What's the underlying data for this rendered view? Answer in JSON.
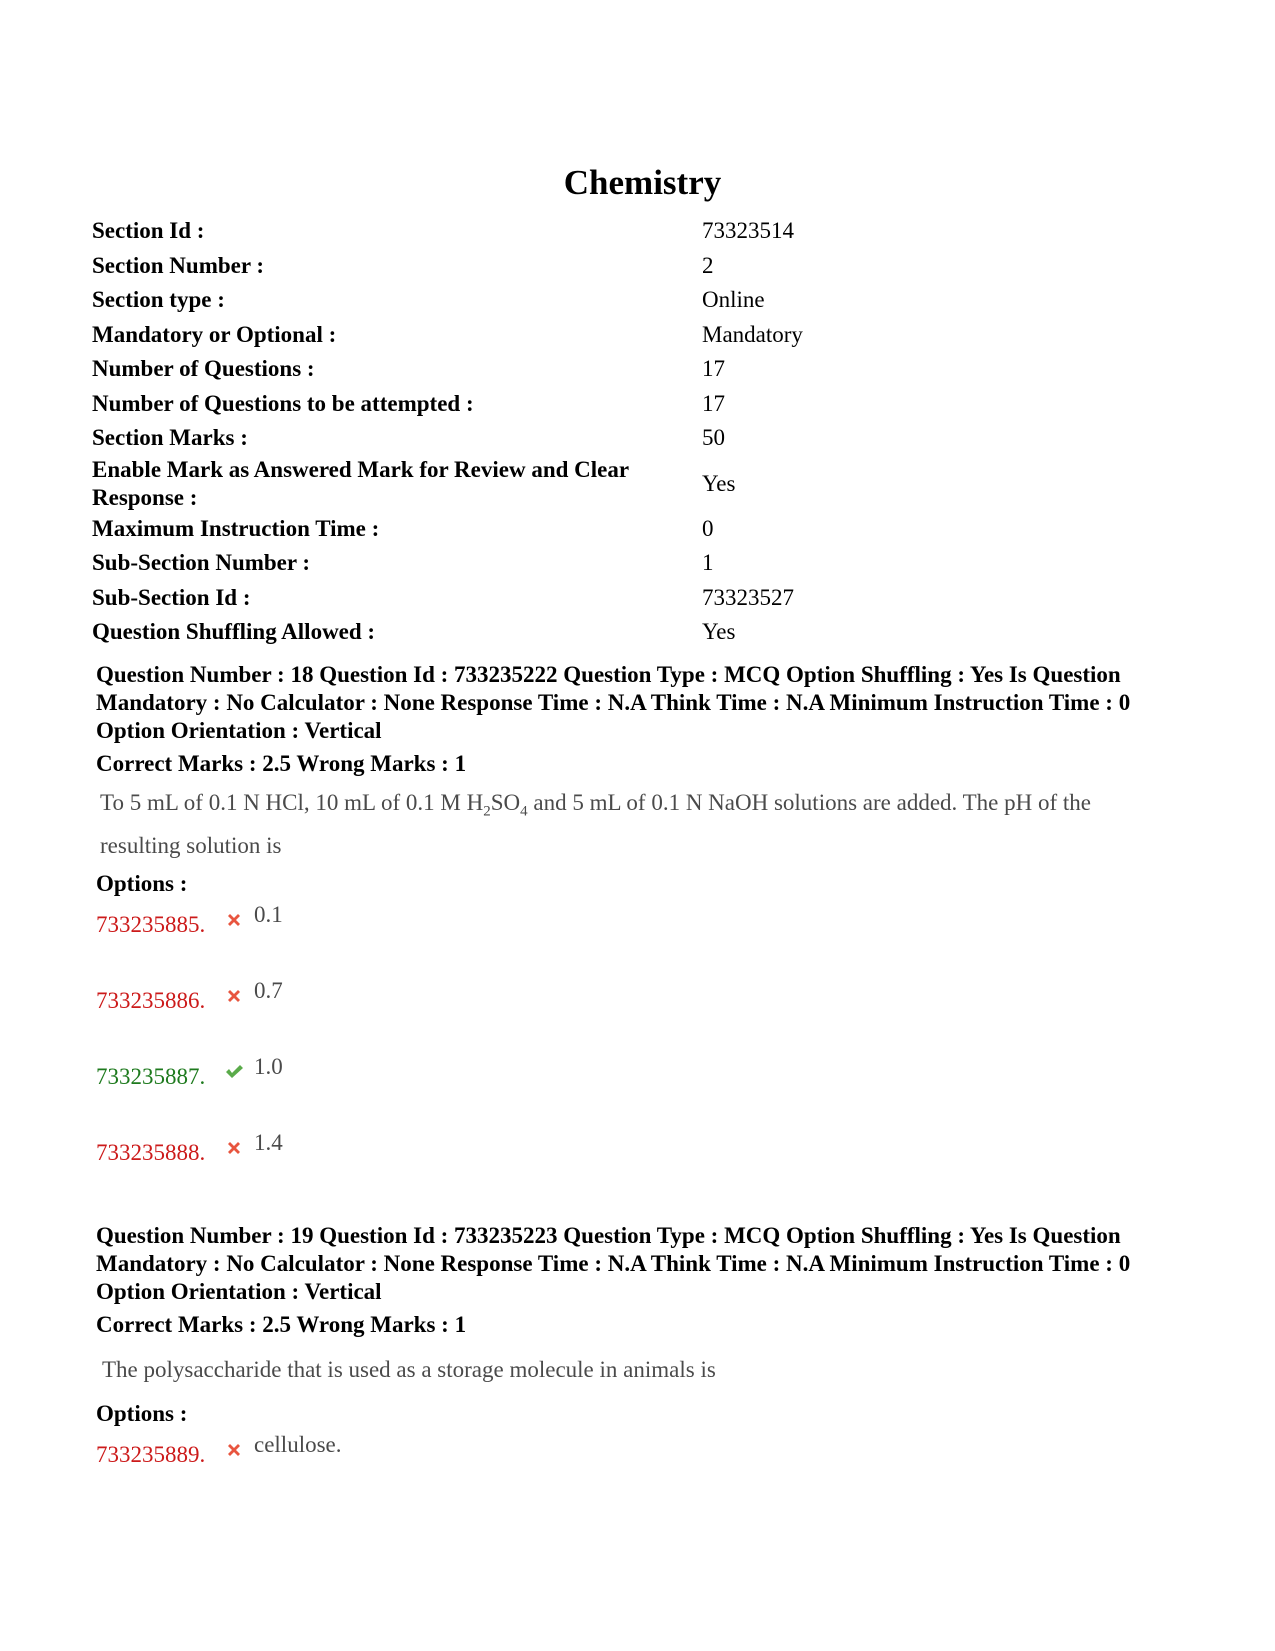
{
  "section": {
    "title": "Chemistry",
    "fields": [
      {
        "label": "Section Id :",
        "value": "73323514"
      },
      {
        "label": "Section Number :",
        "value": "2"
      },
      {
        "label": "Section type :",
        "value": "Online"
      },
      {
        "label": "Mandatory or Optional :",
        "value": "Mandatory"
      },
      {
        "label": "Number of Questions :",
        "value": "17"
      },
      {
        "label": "Number of Questions to be attempted :",
        "value": "17"
      },
      {
        "label": "Section Marks :",
        "value": "50"
      },
      {
        "label": "Enable Mark as Answered Mark for Review and Clear Response :",
        "value": "Yes"
      },
      {
        "label": "Maximum Instruction Time :",
        "value": "0"
      },
      {
        "label": "Sub-Section Number :",
        "value": "1"
      },
      {
        "label": "Sub-Section Id :",
        "value": "73323527"
      },
      {
        "label": "Question Shuffling Allowed :",
        "value": "Yes"
      }
    ]
  },
  "questions": [
    {
      "header": "Question Number : 18 Question Id : 733235222 Question Type : MCQ Option Shuffling : Yes Is Question Mandatory : No Calculator : None Response Time : N.A Think Time : N.A Minimum Instruction Time : 0 Option Orientation : Vertical",
      "marks": "Correct Marks : 2.5 Wrong Marks : 1",
      "text_part1": "To 5 mL of 0.1 N HCl, 10 mL of 0.1 M H",
      "text_sub1": "2",
      "text_part2": "SO",
      "text_sub2": "4",
      "text_part3": " and 5 mL of 0.1 N NaOH solutions are added. The pH of the resulting solution is",
      "options_label": "Options :",
      "options": [
        {
          "id": "733235885.",
          "text": "0.1",
          "correct": false
        },
        {
          "id": "733235886.",
          "text": "0.7",
          "correct": false
        },
        {
          "id": "733235887.",
          "text": "1.0",
          "correct": true
        },
        {
          "id": "733235888.",
          "text": "1.4",
          "correct": false
        }
      ]
    },
    {
      "header": "Question Number : 19 Question Id : 733235223 Question Type : MCQ Option Shuffling : Yes Is Question Mandatory : No Calculator : None Response Time : N.A Think Time : N.A Minimum Instruction Time : 0 Option Orientation : Vertical",
      "marks": "Correct Marks : 2.5 Wrong Marks : 1",
      "text": "The polysaccharide that is used as a storage molecule in animals is",
      "options_label": "Options :",
      "options": [
        {
          "id": "733235889.",
          "text": "cellulose.",
          "correct": false
        }
      ]
    }
  ],
  "colors": {
    "wrong": "#cc1a1a",
    "correct": "#1e7a1e",
    "wrong_icon": "#e8553f",
    "correct_icon": "#5aab4a"
  }
}
